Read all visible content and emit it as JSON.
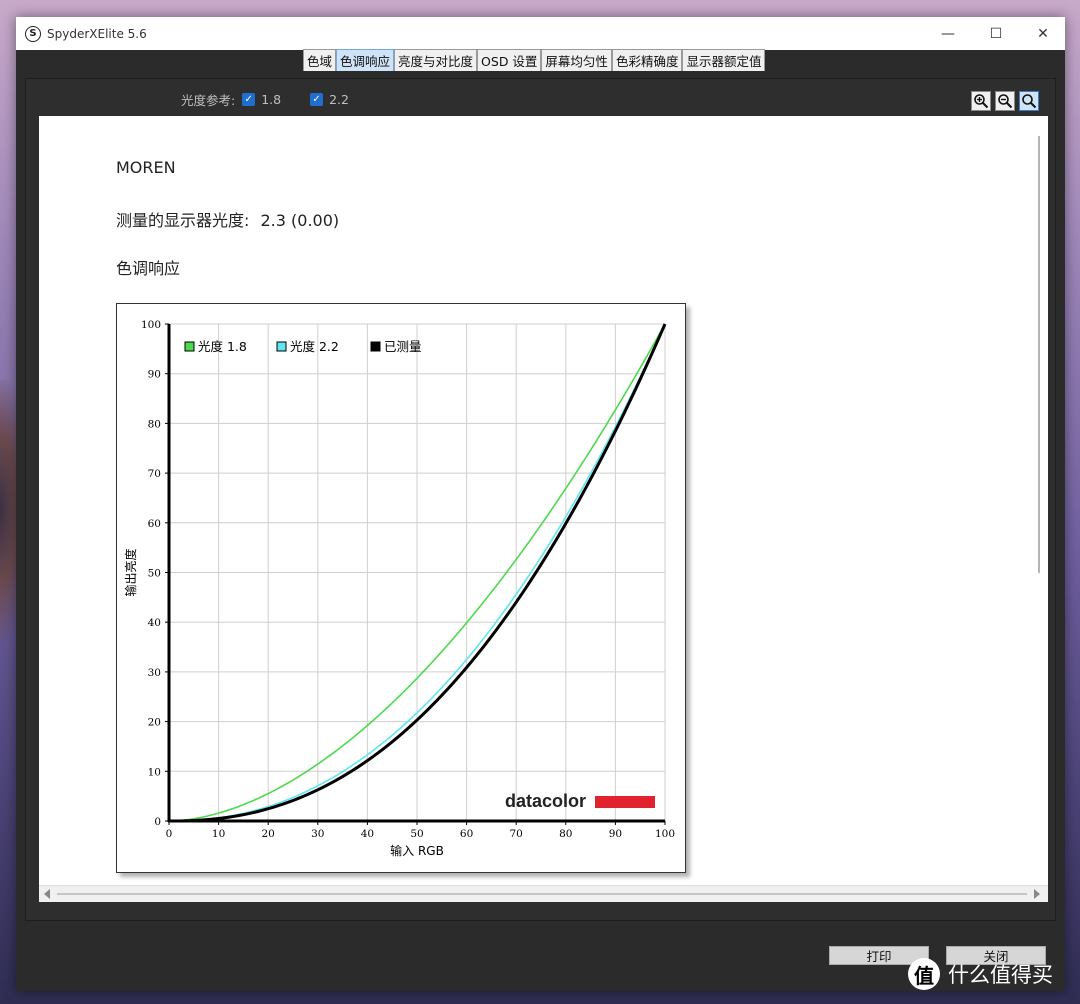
{
  "window": {
    "title": "SpyderXElite 5.6",
    "controls": {
      "minimize": "—",
      "maximize": "☐",
      "close": "✕"
    }
  },
  "tabs": [
    {
      "label": "色域",
      "active": false
    },
    {
      "label": "色调响应",
      "active": true
    },
    {
      "label": "亮度与对比度",
      "active": false
    },
    {
      "label": "OSD 设置",
      "active": false
    },
    {
      "label": "屏幕均匀性",
      "active": false
    },
    {
      "label": "色彩精确度",
      "active": false
    },
    {
      "label": "显示器额定值",
      "active": false
    }
  ],
  "gamma_ref": {
    "label": "光度参考:",
    "options": [
      {
        "value": "1.8",
        "checked": true
      },
      {
        "value": "2.2",
        "checked": true
      }
    ]
  },
  "zoom": {
    "icons": [
      "zoom-in-icon",
      "zoom-out-icon",
      "zoom-fit-icon"
    ]
  },
  "report": {
    "name": "MOREN",
    "measured_label": "测量的显示器光度:",
    "measured_value": "2.3 (0.00)",
    "section_title": "色调响应"
  },
  "chart_data": {
    "type": "line",
    "xlabel": "输入 RGB",
    "ylabel": "输出亮度",
    "xlim": [
      0,
      100
    ],
    "ylim": [
      0,
      100
    ],
    "xticks": [
      0,
      10,
      20,
      30,
      40,
      50,
      60,
      70,
      80,
      90,
      100
    ],
    "yticks": [
      0,
      10,
      20,
      30,
      40,
      50,
      60,
      70,
      80,
      90,
      100
    ],
    "grid": true,
    "legend_position": "top-left",
    "series": [
      {
        "name": "光度 1.8",
        "color": "#4cd94c",
        "gamma": 1.8,
        "x": [
          0,
          10,
          20,
          30,
          40,
          50,
          60,
          70,
          80,
          90,
          100
        ],
        "y": [
          0,
          1.6,
          5.5,
          11.5,
          19.2,
          28.7,
          39.9,
          52.6,
          66.9,
          82.7,
          100
        ]
      },
      {
        "name": "光度 2.2",
        "color": "#5fe6f0",
        "gamma": 2.2,
        "x": [
          0,
          10,
          20,
          30,
          40,
          50,
          60,
          70,
          80,
          90,
          100
        ],
        "y": [
          0,
          0.6,
          2.9,
          7.1,
          13.3,
          21.8,
          32.5,
          45.6,
          61.2,
          79.3,
          100
        ]
      },
      {
        "name": "已测量",
        "color": "#000000",
        "gamma": 2.3,
        "x": [
          0,
          10,
          20,
          30,
          40,
          50,
          60,
          70,
          80,
          90,
          100
        ],
        "y": [
          0,
          0.5,
          2.5,
          6.3,
          12.2,
          20.3,
          30.9,
          43.9,
          59.8,
          78.5,
          100
        ]
      }
    ],
    "brand": "datacolor",
    "brand_color": "#e0232e"
  },
  "buttons": {
    "print": "打印",
    "close": "关闭"
  },
  "watermark": {
    "icon": "值",
    "text": "什么值得买"
  }
}
